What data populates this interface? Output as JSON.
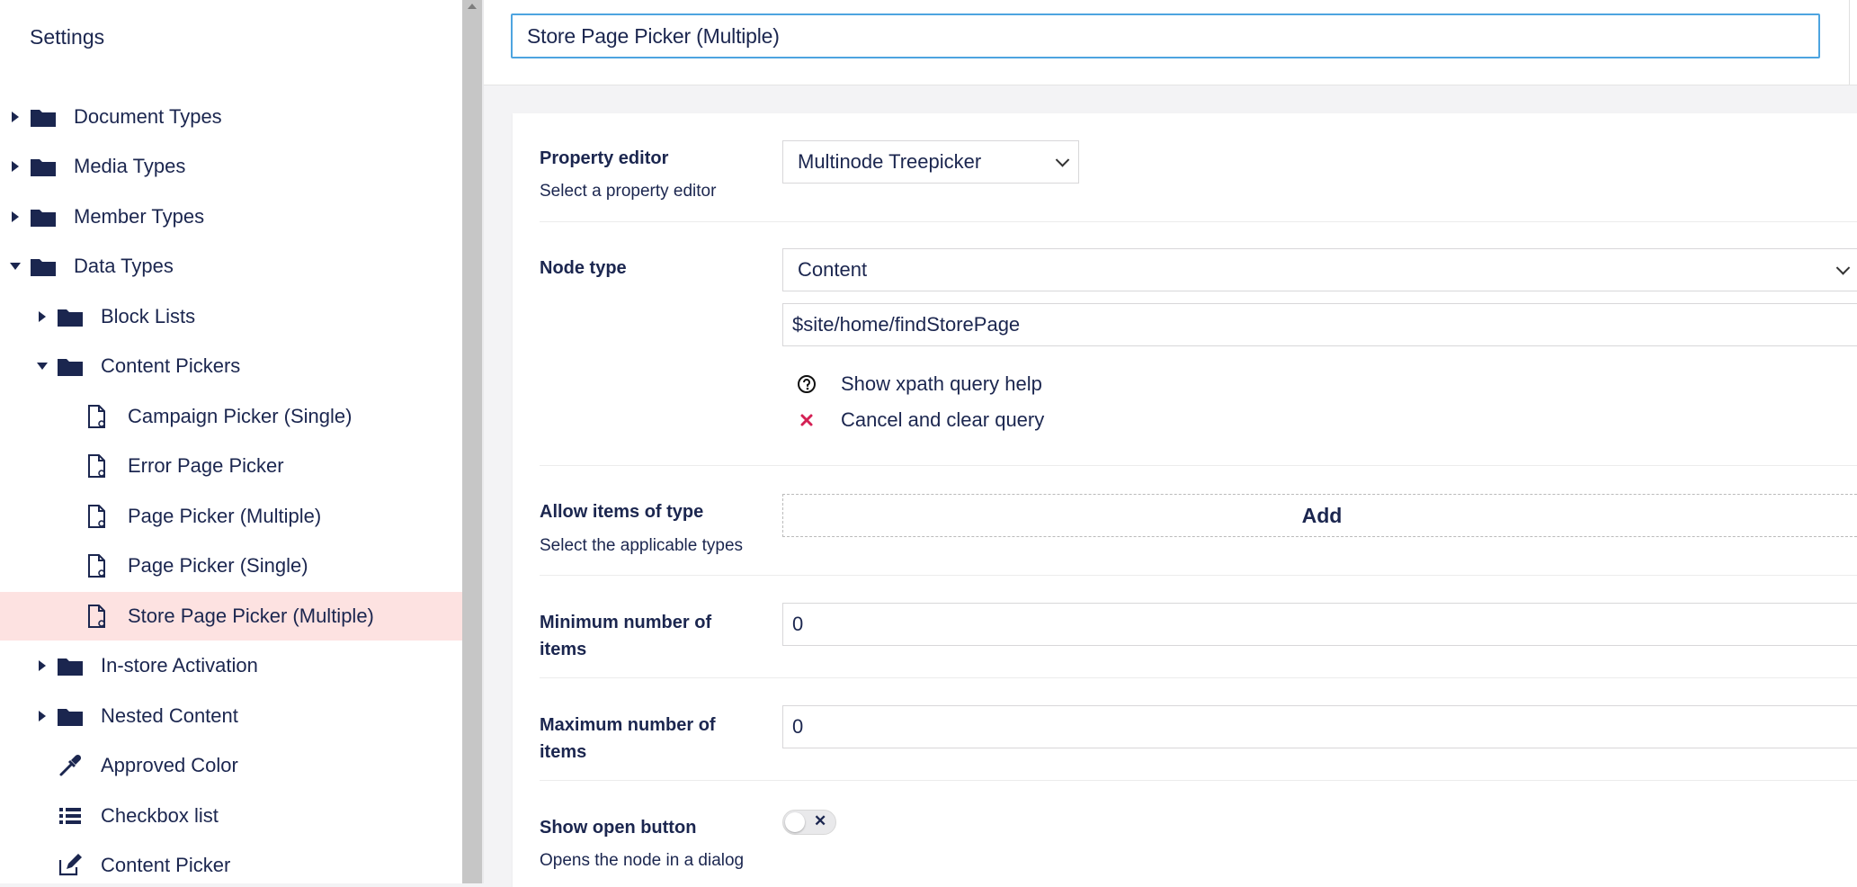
{
  "sidebar": {
    "title": "Settings",
    "items": [
      {
        "label": "Document Types",
        "icon": "folder-icon",
        "expanded": false
      },
      {
        "label": "Media Types",
        "icon": "folder-icon",
        "expanded": false
      },
      {
        "label": "Member Types",
        "icon": "folder-icon",
        "expanded": false
      },
      {
        "label": "Data Types",
        "icon": "folder-icon",
        "expanded": true
      },
      {
        "label": "Block Lists",
        "icon": "folder-icon",
        "expanded": false
      },
      {
        "label": "Content Pickers",
        "icon": "folder-icon",
        "expanded": true
      },
      {
        "label": "Campaign Picker (Single)",
        "icon": "document-icon"
      },
      {
        "label": "Error Page Picker",
        "icon": "document-icon"
      },
      {
        "label": "Page Picker (Multiple)",
        "icon": "document-icon"
      },
      {
        "label": "Page Picker (Single)",
        "icon": "document-icon"
      },
      {
        "label": "Store Page Picker (Multiple)",
        "icon": "document-icon",
        "selected": true
      },
      {
        "label": "In-store Activation",
        "icon": "folder-icon",
        "expanded": false
      },
      {
        "label": "Nested Content",
        "icon": "folder-icon",
        "expanded": false
      },
      {
        "label": "Approved Color",
        "icon": "eyedropper-icon"
      },
      {
        "label": "Checkbox list",
        "icon": "list-icon"
      },
      {
        "label": "Content Picker",
        "icon": "edit-icon"
      }
    ]
  },
  "header": {
    "name_value": "Store Page Picker (Multiple)"
  },
  "editor": {
    "property_editor": {
      "label": "Property editor",
      "description": "Select a property editor",
      "value": "Multinode Treepicker"
    },
    "node_type": {
      "label": "Node type",
      "value": "Content",
      "query": "$site/home/findStorePage",
      "help_label": "Show xpath query help",
      "cancel_label": "Cancel and clear query"
    },
    "allow_items": {
      "label": "Allow items of type",
      "description": "Select the applicable types",
      "add_label": "Add"
    },
    "min_items": {
      "label": "Minimum number of items",
      "value": "0"
    },
    "max_items": {
      "label": "Maximum number of items",
      "value": "0"
    },
    "show_open": {
      "label": "Show open button",
      "description": "Opens the node in a dialog",
      "toggle_symbol": "✕"
    }
  },
  "colors": {
    "text": "#1b264f",
    "selected_bg": "#fde2e1",
    "focus_border": "#4da4e0",
    "cancel_red": "#d42054"
  }
}
